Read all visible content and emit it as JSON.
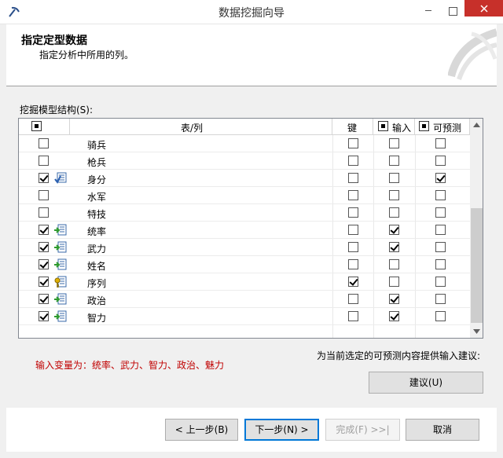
{
  "window": {
    "title": "数据挖掘向导"
  },
  "header": {
    "title": "指定定型数据",
    "subtitle": "指定分析中所用的列。"
  },
  "structure_label": "挖掘模型结构(S):",
  "columns": {
    "table_col": "表/列",
    "key": "键",
    "input": "输入",
    "predictable": "可预测"
  },
  "rows": [
    {
      "name": "骑兵",
      "include": false,
      "icon": "",
      "key": false,
      "input": false,
      "predict": false
    },
    {
      "name": "枪兵",
      "include": false,
      "icon": "",
      "key": false,
      "input": false,
      "predict": false
    },
    {
      "name": "身分",
      "include": true,
      "icon": "predict-column-icon",
      "key": false,
      "input": false,
      "predict": true
    },
    {
      "name": "水军",
      "include": false,
      "icon": "",
      "key": false,
      "input": false,
      "predict": false
    },
    {
      "name": "特技",
      "include": false,
      "icon": "",
      "key": false,
      "input": false,
      "predict": false
    },
    {
      "name": "统率",
      "include": true,
      "icon": "input-column-icon",
      "key": false,
      "input": true,
      "predict": false
    },
    {
      "name": "武力",
      "include": true,
      "icon": "input-column-icon",
      "key": false,
      "input": true,
      "predict": false
    },
    {
      "name": "姓名",
      "include": true,
      "icon": "input-column-icon",
      "key": false,
      "input": false,
      "predict": false
    },
    {
      "name": "序列",
      "include": true,
      "icon": "key-column-icon",
      "key": true,
      "input": false,
      "predict": false
    },
    {
      "name": "政治",
      "include": true,
      "icon": "input-column-icon",
      "key": false,
      "input": true,
      "predict": false
    },
    {
      "name": "智力",
      "include": true,
      "icon": "input-column-icon",
      "key": false,
      "input": true,
      "predict": false
    }
  ],
  "suggest_label": "为当前选定的可预测内容提供输入建议:",
  "input_vars_text": "输入变量为：统率、武力、智力、政治、魅力",
  "buttons": {
    "suggest": "建议(U)",
    "back": "< 上一步(B)",
    "next": "下一步(N) >",
    "finish": "完成(F) >>|",
    "cancel": "取消"
  }
}
